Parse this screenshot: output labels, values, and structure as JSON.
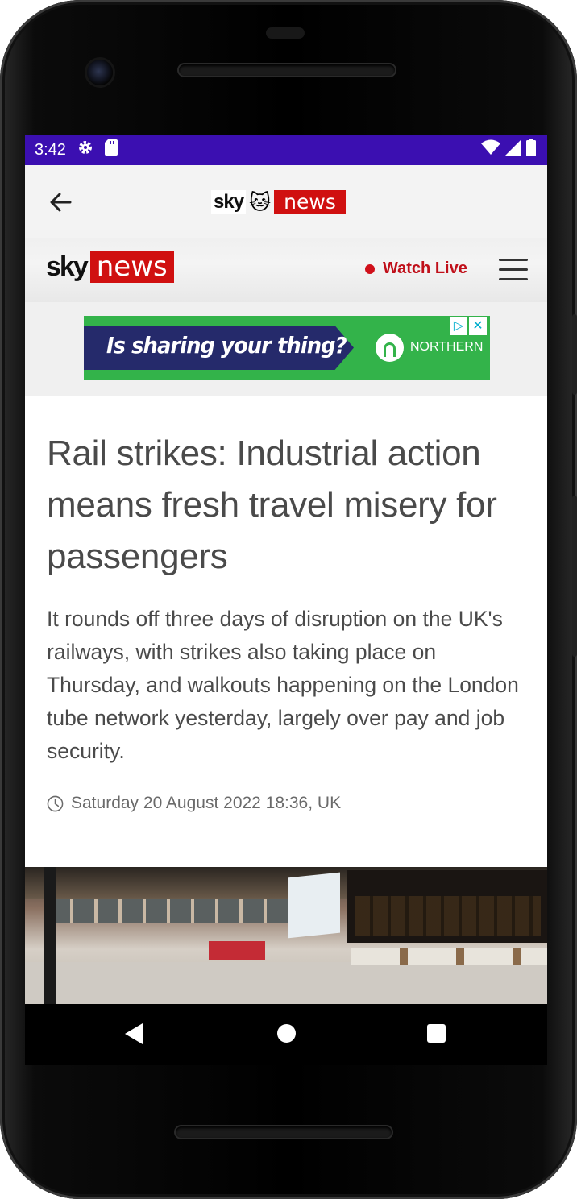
{
  "status_bar": {
    "time": "3:42",
    "icons_left": [
      "gear-icon",
      "sd-card-icon"
    ],
    "icons_right": [
      "wifi-icon",
      "signal-icon",
      "battery-icon"
    ],
    "color": "#3b0fb1"
  },
  "app_bar": {
    "logo_sky": "sky",
    "logo_emoji": "🐱",
    "logo_news": "news"
  },
  "site_header": {
    "logo_sky": "sky",
    "logo_news": "news",
    "watch_live": "Watch Live"
  },
  "ad": {
    "headline": "Is sharing your thing?",
    "brand": "NORTHERN",
    "choices": [
      "▷",
      "✕"
    ]
  },
  "article": {
    "headline": "Rail strikes: Industrial action means fresh travel misery for passengers",
    "standfirst": "It rounds off three days of disruption on the UK's railways, with strikes also taking place on Thursday, and walkouts happening on the London tube network yesterday, largely over pay and job security.",
    "timestamp": "Saturday 20 August 2022 18:36, UK"
  },
  "colors": {
    "brand_red": "#d01010",
    "ad_green": "#33b34a",
    "ad_purple": "#252a6b",
    "text": "#4a4a4a"
  }
}
